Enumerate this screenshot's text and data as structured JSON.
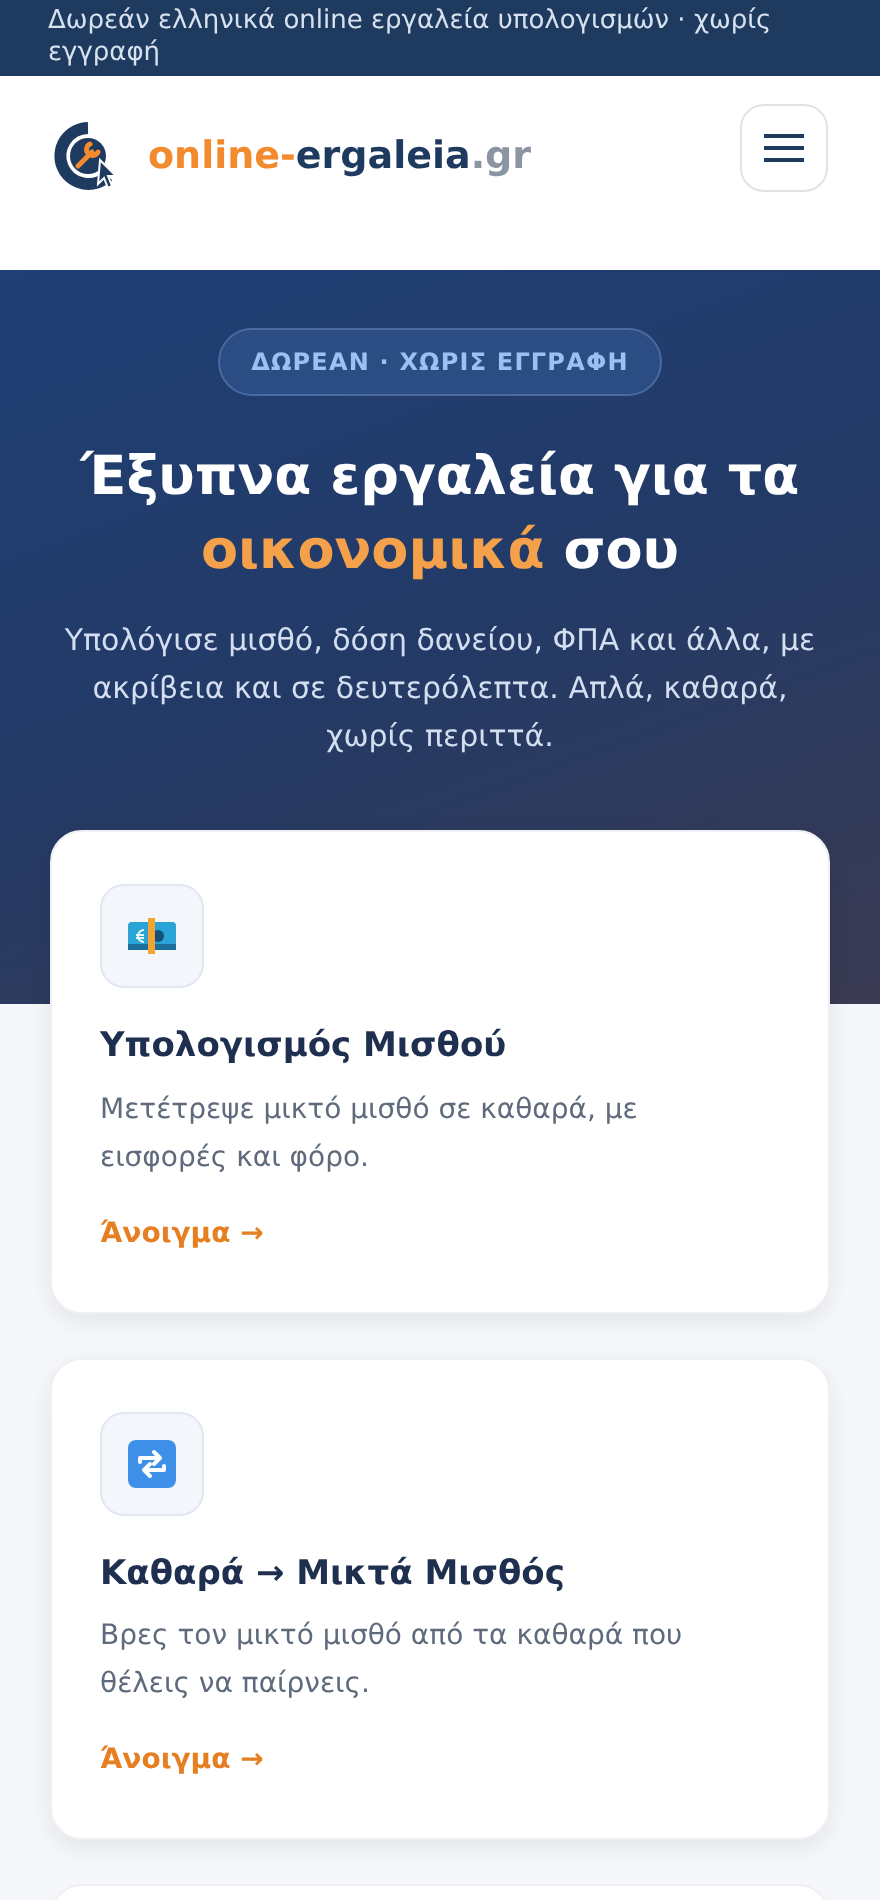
{
  "top_bar": {
    "text": "Δωρεάν ελληνικά online εργαλεία υπολογισμών · χωρίς εγγραφή"
  },
  "header": {
    "logo": [
      {
        "text": "online-",
        "kind": "accent"
      },
      {
        "text": "ergaleia",
        "kind": "main"
      },
      {
        "text": ".gr",
        "kind": "muted"
      }
    ]
  },
  "hero": {
    "badge": "ΔΩΡΕΑΝ · ΧΩΡΙΣ ΕΓΓΡΑΦΗ",
    "title_start": "Έξυπνα εργαλεία για τα",
    "title_highlight": "οικονομικά",
    "title_end": "σου",
    "subtitle": "Υπολόγισε μισθό, δόση δανείου, ΦΠΑ και άλλα, με ακρίβεια και σε δευτερόλεπτα. Απλά, καθαρά, χωρίς περιττά."
  },
  "tools": [
    {
      "kind": "money",
      "title": "Υπολογισμός Μισθού",
      "description": "Μετέτρεψε μικτό μισθό σε καθαρά, με εισφορές και φόρο.",
      "link": "Άνοιγμα →"
    },
    {
      "kind": "repeat",
      "title": "Καθαρά → Μικτά Μισθός",
      "description": "Βρες τον μικτό μισθό από τα καθαρά που θέλεις να παίρνεις.",
      "link": "Άνοιγμα →"
    }
  ]
}
